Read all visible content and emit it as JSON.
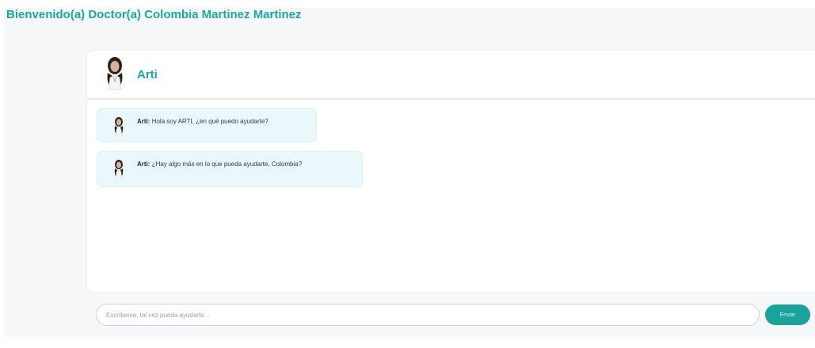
{
  "header": {
    "welcome_text": "Bienvenido(a) Doctor(a) Colombia Martinez Martinez"
  },
  "chat": {
    "title": "Arti",
    "messages": [
      {
        "sender": "Arti:",
        "text": "Hola soy ARTI, ¿en qué puedo ayudarte?"
      },
      {
        "sender": "Arti:",
        "text": "¿Hay algo más en lo que pueda ayudarte, Colombia?"
      }
    ]
  },
  "composer": {
    "placeholder": "Escríbeme, tal vez pueda ayudarte...",
    "send_label": "Enviar"
  },
  "colors": {
    "accent": "#1ba7a1",
    "bubble_bg": "#eaf8fb",
    "send_button": "#19a39b"
  },
  "icons": {
    "assistant_avatar": "woman-doctor-avatar-icon"
  }
}
